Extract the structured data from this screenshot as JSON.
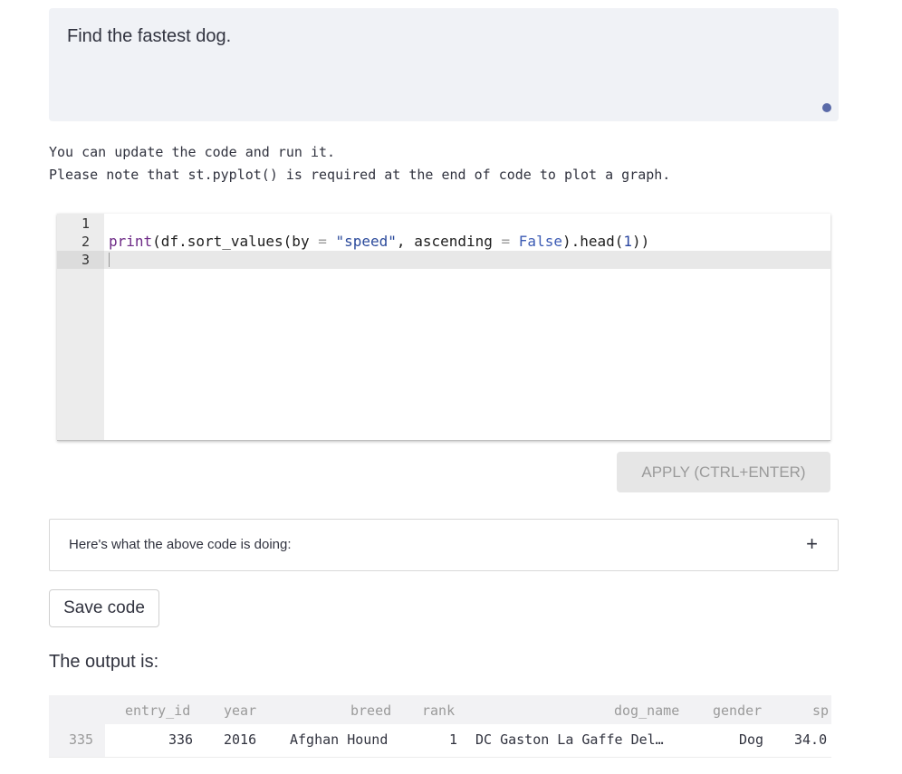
{
  "prompt": {
    "text": "Find the fastest dog."
  },
  "notes": {
    "line1": "You can update the code and run it.",
    "line2": "Please note that st.pyplot() is required at the end of code to plot a graph."
  },
  "editor": {
    "line_numbers": [
      "1",
      "2",
      "3"
    ],
    "code_tokens": {
      "fn": "print",
      "p1": "(df.",
      "method": "sort_values",
      "p2": "(by ",
      "eq1": "=",
      "p3": " ",
      "str": "\"speed\"",
      "p4": ", ascending ",
      "eq2": "=",
      "p5": " ",
      "kw": "False",
      "p6": ").head(",
      "num": "1",
      "p7": "))"
    }
  },
  "apply_button": {
    "label": "APPLY (CTRL+ENTER)"
  },
  "expander": {
    "label": "Here's what the above code is doing:",
    "icon": "plus-icon",
    "symbol": "+"
  },
  "save_button": {
    "label": "Save code"
  },
  "output": {
    "label": "The output is:"
  },
  "table": {
    "columns": [
      "entry_id",
      "year",
      "breed",
      "rank",
      "dog_name",
      "gender",
      "sp"
    ],
    "rows": [
      {
        "index": "335",
        "cells": [
          "336",
          "2016",
          "Afghan Hound",
          "1",
          "DC Gaston La Gaffe Del…",
          "Dog",
          "34.0"
        ]
      }
    ]
  },
  "colors": {
    "accent": "#5a6aa8",
    "prompt_bg": "#f0f2f6"
  }
}
